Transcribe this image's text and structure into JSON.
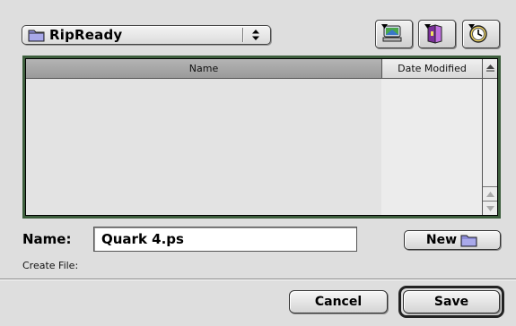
{
  "folder_popup": {
    "label": "RipReady",
    "icon": "folder-icon"
  },
  "toolbar": {
    "shortcuts_icon": "shortcuts-icon",
    "favorites_icon": "favorites-icon",
    "recent_icon": "recent-icon"
  },
  "file_list": {
    "columns": [
      "Name",
      "Date Modified"
    ],
    "rows": [],
    "sort_icon": "sort-order-icon"
  },
  "name_field": {
    "label": "Name:",
    "value": "Quark 4.ps"
  },
  "create_file_label": "Create File:",
  "new_button": {
    "label": "New",
    "icon": "new-folder-icon"
  },
  "buttons": {
    "cancel": "Cancel",
    "save": "Save"
  },
  "colors": {
    "list_focus_border": "#3d5e3d",
    "background": "#dedede"
  }
}
